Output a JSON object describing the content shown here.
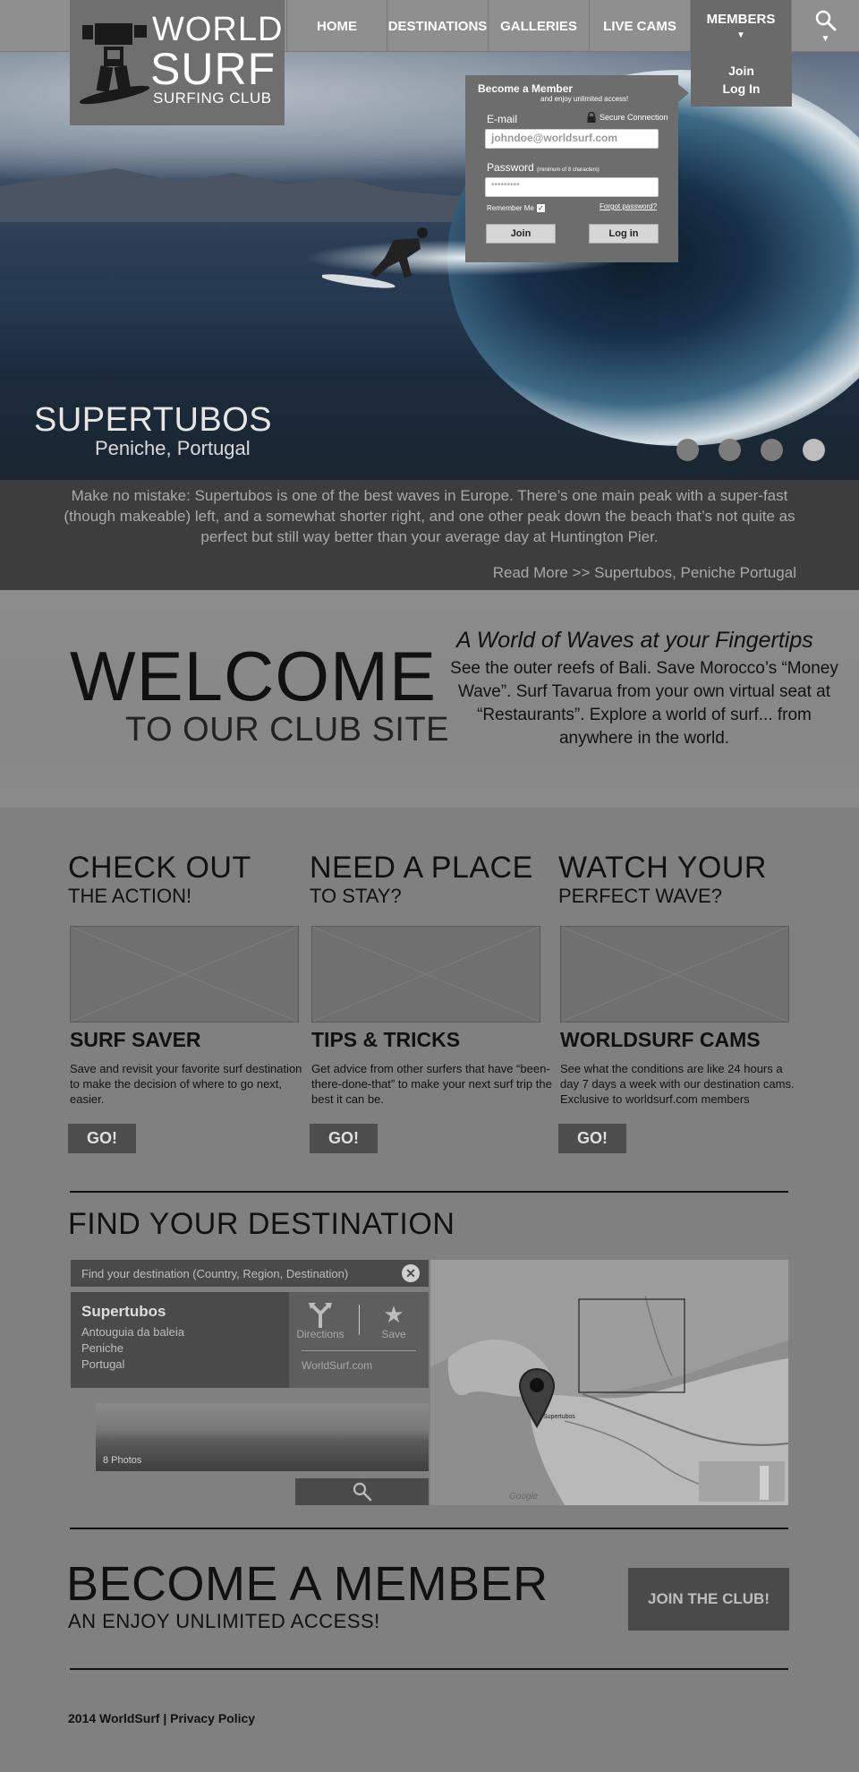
{
  "brand": {
    "line1": "WORLD",
    "line2": "SURF",
    "line3": "SURFING CLUB"
  },
  "nav": {
    "items": [
      "HOME",
      "DESTINATIONS",
      "GALLERIES",
      "LIVE CAMS",
      "MEMBERS"
    ],
    "members_menu": [
      "Join",
      "Log In"
    ]
  },
  "login": {
    "title": "Become a Member",
    "subtitle": "and enjoy unlimited access!",
    "email_label": "E-mail",
    "secure": "Secure Connection",
    "email_value": "johndoe@worldsurf.com",
    "password_label": "Password",
    "password_hint": "(minimum of 8 characters)",
    "password_value": "•••••••••",
    "remember": "Remember Me",
    "forgot": "Forgot password?",
    "join": "Join",
    "login": "Log in"
  },
  "hero": {
    "title": "SUPERTUBOS",
    "subtitle": "Peniche, Portugal",
    "slide_count": 4,
    "active_slide": 4
  },
  "caption": {
    "text": "Make no mistake: Supertubos is one of the best waves in Europe. There’s one main peak with a super-fast (though makeable) left, and a somewhat shorter right, and one other peak down the beach that’s not quite as perfect but still way better than your average day at Huntington Pier.",
    "read_more": "Read More >> Supertubos, Peniche Portugal"
  },
  "welcome": {
    "big": "WELCOME",
    "small": "TO OUR CLUB SITE",
    "heading": "A World of  Waves at your Fingertips",
    "text": "See the outer reefs of Bali. Save Morocco’s “Money Wave”. Surf Tavarua from your own virtual seat at “Restaurants”. Explore a world of surf... from anywhere in the world."
  },
  "features": [
    {
      "big": "CHECK OUT",
      "small": "THE ACTION!",
      "title": "SURF SAVER",
      "text": "Save and revisit your favorite surf destination to make the decision of where to go next, easier.",
      "cta": "GO!"
    },
    {
      "big": "NEED A PLACE",
      "small": "TO STAY?",
      "title": "TIPS & TRICKS",
      "text": "Get advice from other surfers that have “been-there-done-that” to make your next surf trip the best it can be.",
      "cta": "GO!"
    },
    {
      "big": "WATCH YOUR",
      "small": "PERFECT WAVE?",
      "title": "WORLDSURF CAMS",
      "text": "See what the conditions are like 24 hours a day 7 days a week with our destination cams. Exclusive to worldsurf.com members",
      "cta": "GO!"
    }
  ],
  "find": {
    "title": "FIND YOUR DESTINATION",
    "placeholder": "Find your destination (Country, Region, Destination)",
    "result": {
      "name": "Supertubos",
      "address": [
        "Antouguia da baleia",
        "Peniche",
        "Portugal"
      ],
      "directions": "Directions",
      "save": "Save",
      "site": "WorldSurf.com"
    },
    "photos": "8 Photos",
    "map_label": "Supertubos",
    "map_credit": "Google"
  },
  "member_cta": {
    "big": "BECOME A MEMBER",
    "small": "AN ENJOY UNLIMITED ACCESS!",
    "button": "JOIN THE CLUB!"
  },
  "footer": {
    "text": "2014 WorldSurf | Privacy Policy"
  },
  "icons": {
    "search": "magnifier-icon",
    "close": "close-circle-icon",
    "directions": "directions-icon",
    "save": "star-icon",
    "lock": "lock-icon",
    "map_pin": "map-pin-icon"
  }
}
